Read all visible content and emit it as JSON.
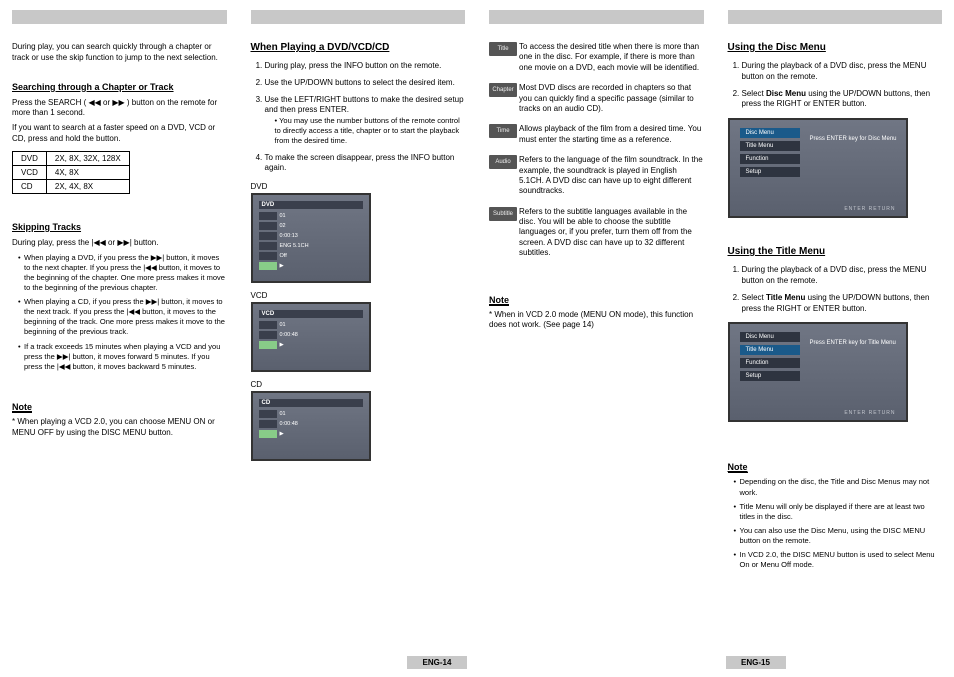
{
  "col1": {
    "intro": "During play, you can search quickly through a chapter or track or use the skip function to jump to the next selection.",
    "h1": "Searching through a Chapter or Track",
    "p1a": "Press the SEARCH ( ◀◀ or ▶▶ ) button on the remote for more than 1 second.",
    "p1b": "If you want to search at a faster speed on a DVD, VCD or CD, press and hold the button.",
    "table": [
      [
        "DVD",
        "2X, 8X, 32X, 128X"
      ],
      [
        "VCD",
        "4X, 8X"
      ],
      [
        "CD",
        "2X, 4X, 8X"
      ]
    ],
    "h2": "Skipping Tracks",
    "p2": "During play, press the  |◀◀  or  ▶▶|  button.",
    "bullets": [
      "When playing a DVD, if you press the ▶▶| button, it moves to the next chapter. If you press the |◀◀ button, it moves to the beginning of the chapter. One more press makes it move to the beginning of the previous chapter.",
      "When playing a CD, if you press the ▶▶| button, it moves to the next track. If you press the |◀◀ button, it moves to the beginning of the track. One more press makes it move to the beginning of the previous track.",
      "If a track exceeds 15 minutes when playing a VCD and you press the ▶▶| button, it moves forward 5 minutes. If you press the |◀◀ button, it moves backward 5 minutes."
    ],
    "noteh": "Note",
    "note": "* When playing a VCD 2.0, you can choose MENU ON or MENU OFF by using the DISC MENU button."
  },
  "col2": {
    "h": "When Playing a DVD/VCD/CD",
    "steps": [
      "During play, press the INFO button on the remote.",
      "Use the UP/DOWN buttons to select the desired item.",
      "Use the LEFT/RIGHT buttons to make the desired setup and then press ENTER.",
      "To make the screen disappear, press the INFO button again."
    ],
    "sub3": "You may use the number buttons of the remote control to directly access a title, chapter or to start the playback from the desired time.",
    "labels": {
      "dvd": "DVD",
      "vcd": "VCD",
      "cd": "CD"
    },
    "dvd_rows": [
      "DVD",
      "01",
      "02",
      "0:00:13",
      "ENG 5.1CH",
      "Off",
      "▶"
    ],
    "vcd_rows": [
      "VCD",
      "01",
      "0:00:48",
      "▶"
    ],
    "cd_rows": [
      "CD",
      "01",
      "0:00:48",
      "▶"
    ]
  },
  "col3": {
    "gloss": [
      {
        "label": "Title",
        "sym": "⌾",
        "text": "To access the desired title when there is more than one in the disc. For example, if there is more than one movie on a DVD, each movie will be identified."
      },
      {
        "label": "Chapter",
        "sym": "⌾",
        "text": "Most DVD discs are recorded in chapters so that you can quickly find a specific passage (similar to tracks on an audio CD)."
      },
      {
        "label": "Time",
        "sym": "⊙",
        "text": "Allows playback of the film from a desired time. You must enter the starting time as a reference."
      },
      {
        "label": "Audio",
        "sym": "🔊",
        "text": "Refers to the language of the film soundtrack. In the example, the soundtrack is played in English 5.1CH. A DVD disc can have up to eight different soundtracks."
      },
      {
        "label": "Subtitle",
        "sym": "▭",
        "text": "Refers to the subtitle languages available in the disc. You will be able to choose the subtitle languages or, if you prefer, turn them off from the screen. A DVD disc can have up to 32 different subtitles."
      }
    ],
    "noteh": "Note",
    "note": "* When in VCD 2.0 mode (MENU ON mode), this function does not work. (See page 14)"
  },
  "col4": {
    "h1": "Using the Disc Menu",
    "steps1": [
      "During the playback of a DVD disc, press the MENU button on the remote."
    ],
    "step1b_pre": "Select ",
    "step1b_bold": "Disc Menu",
    "step1b_post": " using the UP/DOWN buttons, then press the RIGHT or ENTER button.",
    "screen1": {
      "items": [
        "Disc Menu",
        "Title Menu",
        "Function",
        "Setup"
      ],
      "hint": "Press ENTER key for Disc Menu",
      "foot": "ENTER   RETURN"
    },
    "h2": "Using the Title Menu",
    "steps2": [
      "During the playback of a DVD disc, press the MENU button on the remote."
    ],
    "step2b_pre": "Select ",
    "step2b_bold": "Title Menu",
    "step2b_post": " using the UP/DOWN buttons, then press the RIGHT or ENTER button.",
    "screen2": {
      "items": [
        "Disc Menu",
        "Title Menu",
        "Function",
        "Setup"
      ],
      "hint": "Press ENTER key for Title Menu",
      "foot": "ENTER   RETURN"
    },
    "noteh": "Note",
    "notes": [
      "Depending on the disc, the Title and Disc Menus may not work.",
      "Title Menu will only be displayed if there are at least two titles in the disc.",
      "You can also use the Disc Menu, using the DISC MENU button on the remote.",
      "In VCD 2.0, the DISC MENU button is used to select Menu On or Menu Off mode."
    ]
  },
  "pagenums": {
    "l": "ENG-14",
    "r": "ENG-15"
  }
}
